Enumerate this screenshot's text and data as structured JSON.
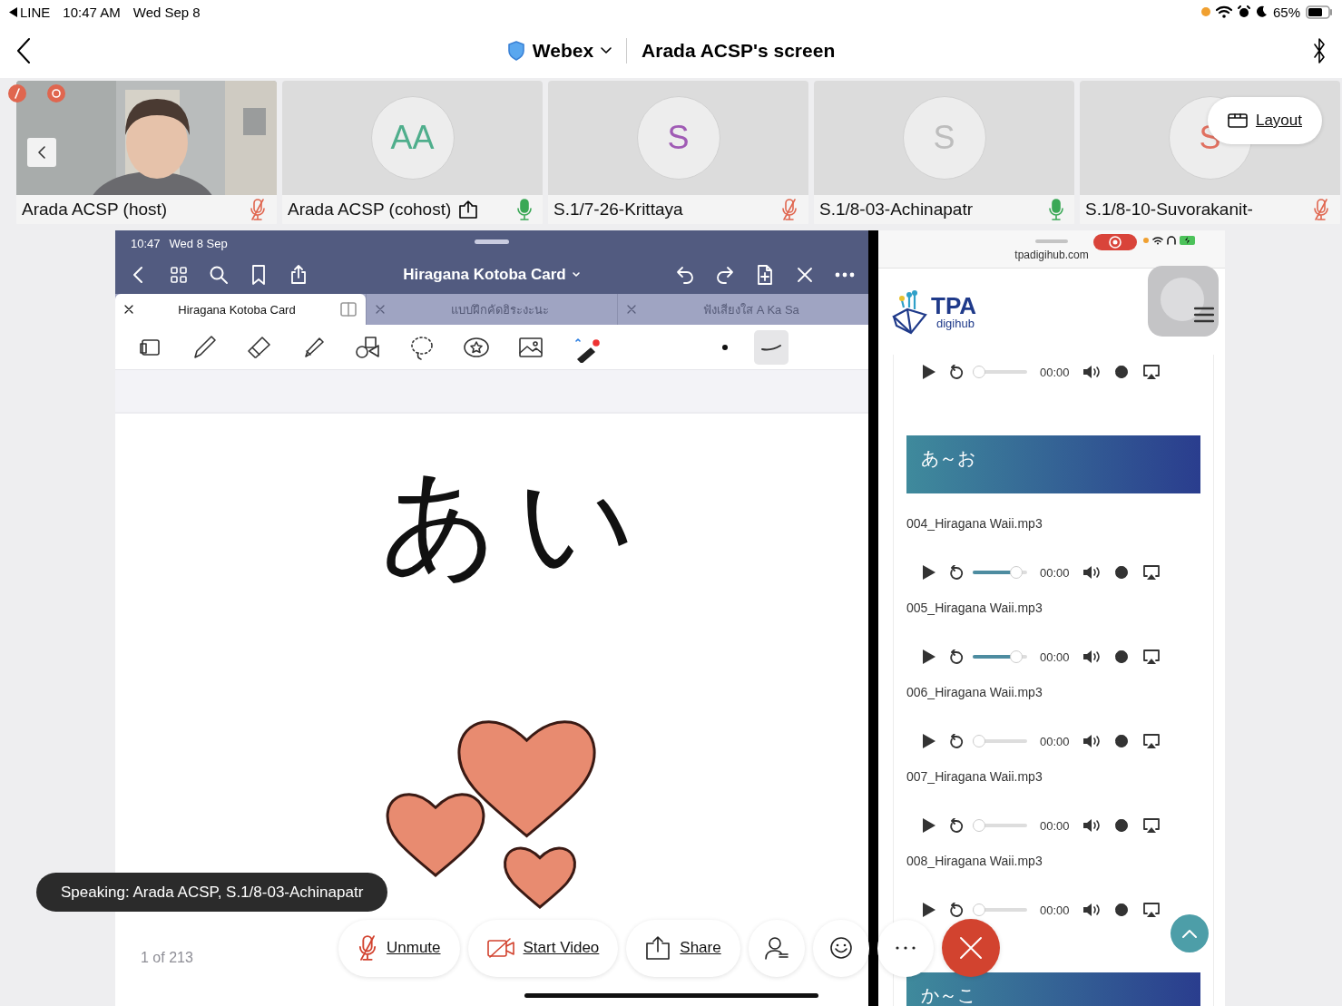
{
  "status_bar": {
    "back_app": "LINE",
    "time": "10:47 AM",
    "date": "Wed Sep 8",
    "battery": "65%"
  },
  "header": {
    "app": "Webex",
    "title": "Arada ACSP's screen"
  },
  "participants": [
    {
      "kind": "video",
      "name": "Arada ACSP (host)",
      "muted": true,
      "sharing": false
    },
    {
      "kind": "avatar",
      "initials": "AA",
      "color": "#4fae8c",
      "name": "Arada ACSP (cohost)",
      "muted": false,
      "sharing": true
    },
    {
      "kind": "avatar",
      "initials": "S",
      "color": "#a05bb5",
      "name": "S.1/7-26-Krittaya",
      "muted": true,
      "sharing": false
    },
    {
      "kind": "avatar",
      "initials": "S",
      "color": "#bdbdbd",
      "name": "S.1/8-03-Achinapatr",
      "muted": false,
      "sharing": false
    },
    {
      "kind": "avatar",
      "initials": "S",
      "color": "#e07060",
      "name": "S.1/8-10-Suvorakanit-",
      "muted": true,
      "sharing": false
    }
  ],
  "layout_button": "Layout",
  "notes_app": {
    "time": "10:47",
    "date": "Wed 8 Sep",
    "title": "Hiragana Kotoba Card",
    "tabs": [
      {
        "label": "Hiragana Kotoba Card",
        "selected": true
      },
      {
        "label": "แบบฝึกคัดฮิระงะนะ",
        "selected": false
      },
      {
        "label": "ฟังเสียงใส A Ka Sa",
        "selected": false
      }
    ],
    "handwriting": "あい",
    "page": "1 of 213"
  },
  "browser": {
    "url": "tpadigihub.com",
    "logo": "TPA",
    "logo_sub": "digihub",
    "items": [
      {
        "kind": "player",
        "level": 0,
        "time": "00:00"
      },
      {
        "kind": "section",
        "label": "あ～お"
      },
      {
        "kind": "file",
        "name": "004_Hiragana Waii.mp3"
      },
      {
        "kind": "player",
        "level": 0.9,
        "time": "00:00"
      },
      {
        "kind": "file",
        "name": "005_Hiragana Waii.mp3"
      },
      {
        "kind": "player",
        "level": 0.9,
        "time": "00:00"
      },
      {
        "kind": "file",
        "name": "006_Hiragana Waii.mp3"
      },
      {
        "kind": "player",
        "level": 0,
        "time": "00:00"
      },
      {
        "kind": "file",
        "name": "007_Hiragana Waii.mp3"
      },
      {
        "kind": "player",
        "level": 0,
        "time": "00:00"
      },
      {
        "kind": "file",
        "name": "008_Hiragana Waii.mp3"
      },
      {
        "kind": "player",
        "level": 0,
        "time": "00:00"
      },
      {
        "kind": "section",
        "label": "か～こ"
      }
    ]
  },
  "speaking": "Speaking: Arada ACSP, S.1/8-03-Achinapatr",
  "controls": [
    {
      "kind": "mute",
      "label": "Unmute"
    },
    {
      "kind": "video",
      "label": "Start Video"
    },
    {
      "kind": "share",
      "label": "Share"
    },
    {
      "kind": "participants"
    },
    {
      "kind": "reactions"
    },
    {
      "kind": "more"
    },
    {
      "kind": "end"
    }
  ]
}
